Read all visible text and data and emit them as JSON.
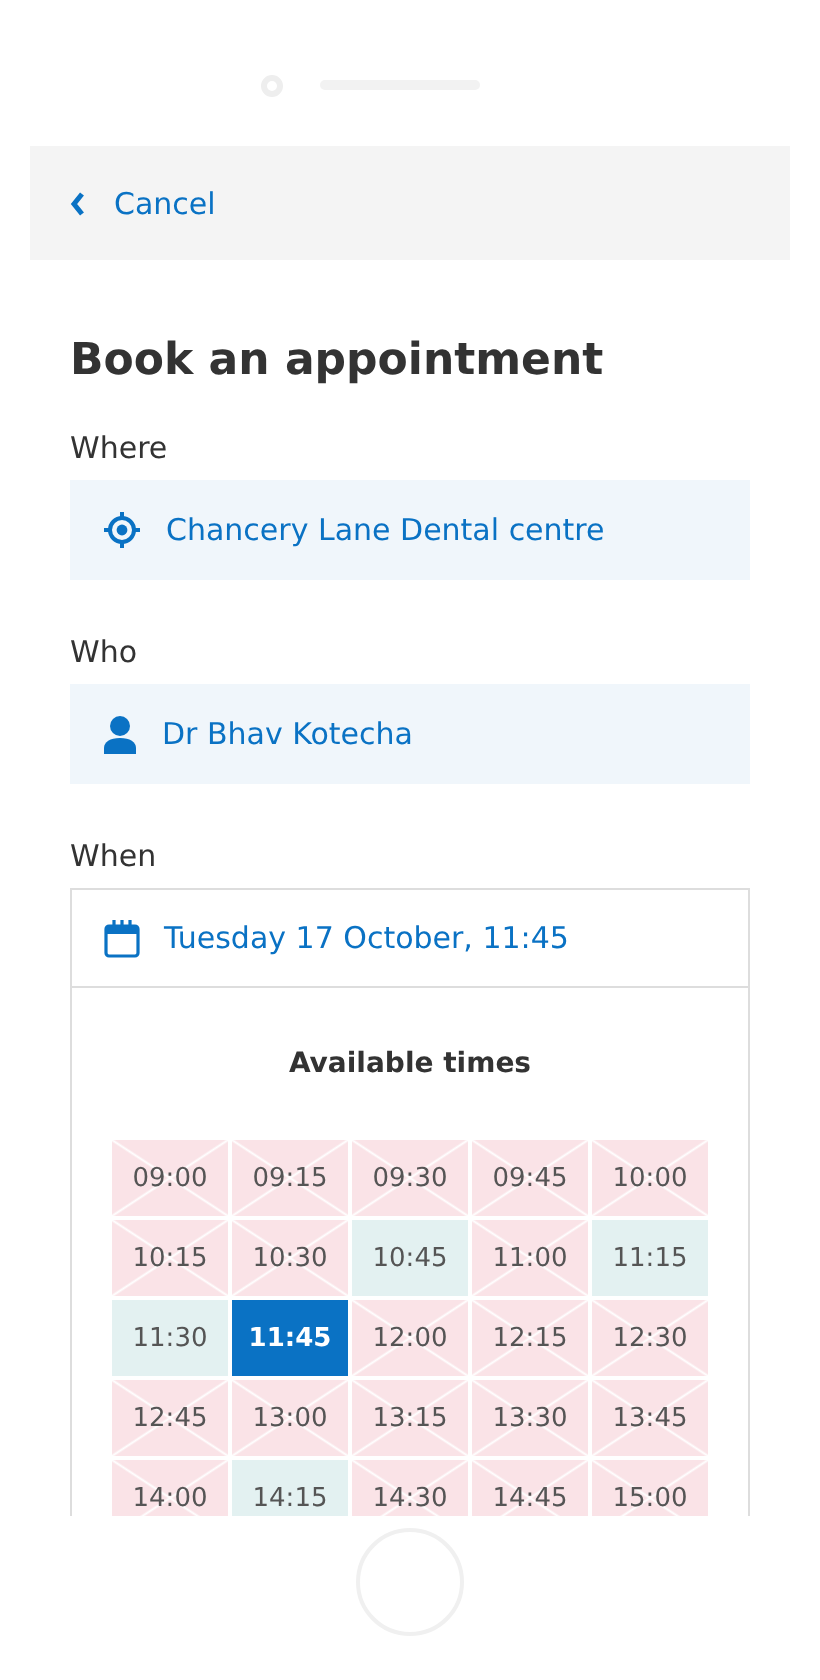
{
  "header": {
    "back_label": "Cancel"
  },
  "title": "Book an appointment",
  "fields": [
    {
      "label": "Where",
      "kind": "location",
      "value": "Chancery Lane Dental centre"
    },
    {
      "label": "Who",
      "kind": "person",
      "value": "Dr Bhav Kotecha"
    },
    {
      "label": "When",
      "kind": "date",
      "value": "Tuesday 17 October, 11:45"
    }
  ],
  "times": {
    "heading": "Available times",
    "slots": [
      {
        "time": "09:00",
        "available": false,
        "selected": false
      },
      {
        "time": "09:15",
        "available": false,
        "selected": false
      },
      {
        "time": "09:30",
        "available": false,
        "selected": false
      },
      {
        "time": "09:45",
        "available": false,
        "selected": false
      },
      {
        "time": "10:00",
        "available": false,
        "selected": false
      },
      {
        "time": "10:15",
        "available": false,
        "selected": false
      },
      {
        "time": "10:30",
        "available": false,
        "selected": false
      },
      {
        "time": "10:45",
        "available": true,
        "selected": false
      },
      {
        "time": "11:00",
        "available": false,
        "selected": false
      },
      {
        "time": "11:15",
        "available": true,
        "selected": false
      },
      {
        "time": "11:30",
        "available": true,
        "selected": false
      },
      {
        "time": "11:45",
        "available": true,
        "selected": true
      },
      {
        "time": "12:00",
        "available": false,
        "selected": false
      },
      {
        "time": "12:15",
        "available": false,
        "selected": false
      },
      {
        "time": "12:30",
        "available": false,
        "selected": false
      },
      {
        "time": "12:45",
        "available": false,
        "selected": false
      },
      {
        "time": "13:00",
        "available": false,
        "selected": false
      },
      {
        "time": "13:15",
        "available": false,
        "selected": false
      },
      {
        "time": "13:30",
        "available": false,
        "selected": false
      },
      {
        "time": "13:45",
        "available": false,
        "selected": false
      },
      {
        "time": "14:00",
        "available": false,
        "selected": false
      },
      {
        "time": "14:15",
        "available": true,
        "selected": false
      },
      {
        "time": "14:30",
        "available": false,
        "selected": false
      },
      {
        "time": "14:45",
        "available": false,
        "selected": false
      },
      {
        "time": "15:00",
        "available": false,
        "selected": false
      }
    ]
  }
}
